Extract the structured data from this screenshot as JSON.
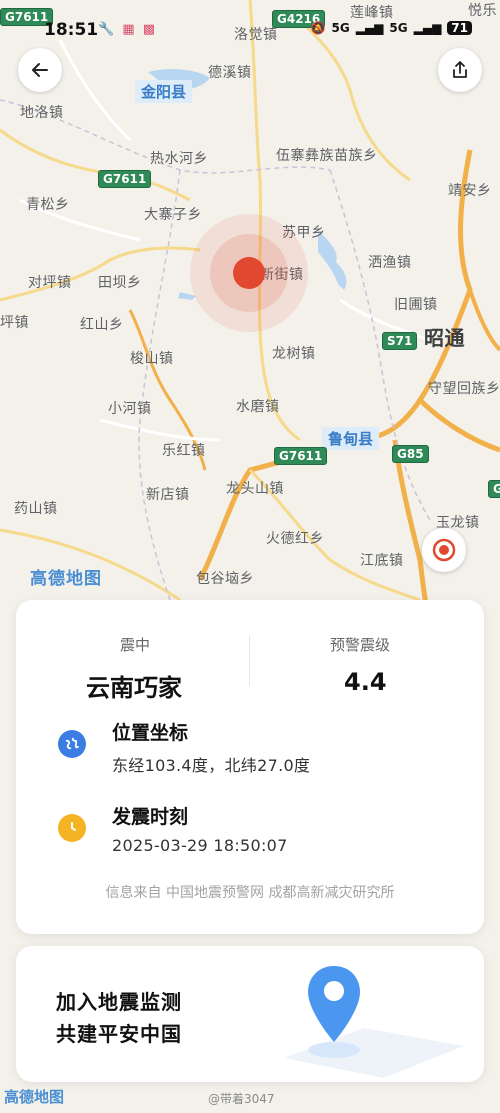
{
  "status_bar": {
    "time": "18:51",
    "left_icons": [
      "wrench-icon",
      "app-icon",
      "app-icon",
      "app-icon"
    ],
    "right_icons": [
      "bell-off-icon",
      "5G",
      "5G"
    ],
    "battery": "71"
  },
  "map": {
    "places": [
      {
        "name": "洛觉镇"
      },
      {
        "name": "德溪镇"
      },
      {
        "name": "地洛镇"
      },
      {
        "name": "热水河乡"
      },
      {
        "name": "伍寨彝族苗族乡"
      },
      {
        "name": "青松乡"
      },
      {
        "name": "大寨子乡"
      },
      {
        "name": "苏甲乡"
      },
      {
        "name": "靖安乡"
      },
      {
        "name": "对坪镇"
      },
      {
        "name": "田坝乡"
      },
      {
        "name": "新街镇"
      },
      {
        "name": "洒渔镇"
      },
      {
        "name": "旧圃镇"
      },
      {
        "name": "红山乡"
      },
      {
        "name": "龙树镇"
      },
      {
        "name": "梭山镇"
      },
      {
        "name": "守望回族乡"
      },
      {
        "name": "小河镇"
      },
      {
        "name": "水磨镇"
      },
      {
        "name": "乐红镇"
      },
      {
        "name": "新店镇"
      },
      {
        "name": "龙头山镇"
      },
      {
        "name": "药山镇"
      },
      {
        "name": "玉龙镇"
      },
      {
        "name": "火德红乡"
      },
      {
        "name": "江底镇"
      },
      {
        "name": "包谷垴乡"
      },
      {
        "name": "莲峰镇"
      },
      {
        "name": "坪镇"
      },
      {
        "name": "悦乐"
      }
    ],
    "city": "昭通",
    "counties": [
      "金阳县",
      "鲁甸县"
    ],
    "highways": [
      "G7611",
      "G4216",
      "G7611",
      "S71",
      "G7611",
      "G85",
      "G"
    ],
    "attribution": "高德地图"
  },
  "info": {
    "epicenter_label": "震中",
    "epicenter_value": "云南巧家",
    "level_label": "预警震级",
    "level_value": "4.4",
    "coords_title": "位置坐标",
    "coords_value": "东经103.4度，北纬27.0度",
    "time_title": "发震时刻",
    "time_value": "2025-03-29 18:50:07",
    "source": "信息来自 中国地震预警网 成都高新减灾研究所"
  },
  "join": {
    "line1": "加入地震监测",
    "line2": "共建平安中国"
  },
  "watermark": "@带着3047",
  "colors": {
    "quake": "#e0492f",
    "globe": "#3b7de3",
    "clock": "#f4b323",
    "pin": "#4b97ef"
  }
}
